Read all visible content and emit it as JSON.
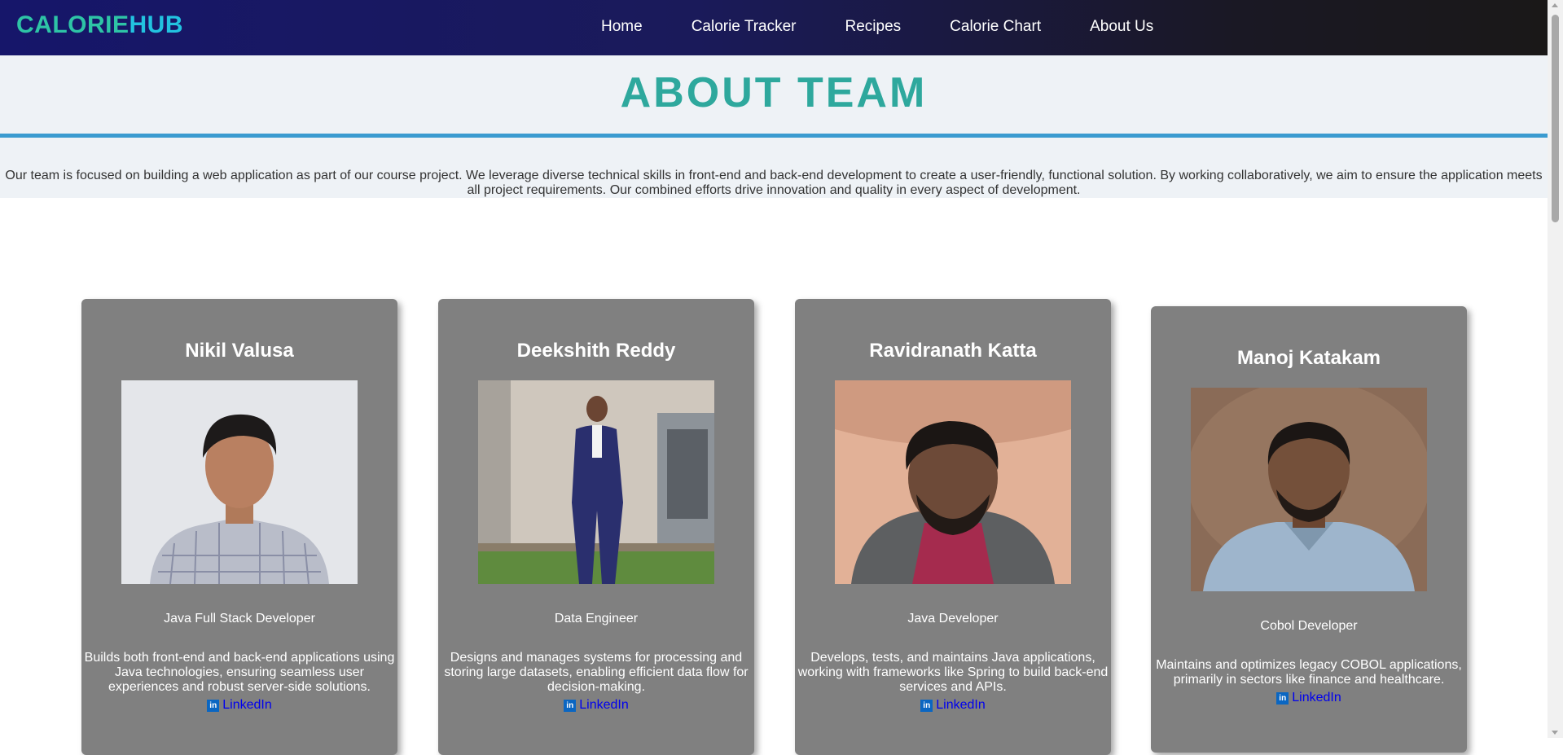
{
  "brand": {
    "part1": "CALORIE",
    "part2": "HUB"
  },
  "nav": [
    "Home",
    "Calorie Tracker",
    "Recipes",
    "Calorie Chart",
    "About Us"
  ],
  "header": {
    "title": "ABOUT TEAM"
  },
  "intro": "Our team is focused on building a web application as part of our course project. We leverage diverse technical skills in front-end and back-end development to create a user-friendly, functional solution. By working collaboratively, we aim to ensure the application meets all project requirements. Our combined efforts drive innovation and quality in every aspect of development.",
  "members": [
    {
      "name": "Nikil Valusa",
      "role": "Java Full Stack Developer",
      "desc": "Builds both front-end and back-end applications using Java technologies, ensuring seamless user experiences and robust server-side solutions.",
      "link": "LinkedIn"
    },
    {
      "name": "Deekshith Reddy",
      "role": "Data Engineer",
      "desc": "Designs and manages systems for processing and storing large datasets, enabling efficient data flow for decision-making.",
      "link": "LinkedIn"
    },
    {
      "name": "Ravidranath Katta",
      "role": "Java Developer",
      "desc": "Develops, tests, and maintains Java applications, working with frameworks like Spring to build back-end services and APIs.",
      "link": "LinkedIn"
    },
    {
      "name": "Manoj Katakam",
      "role": "Cobol Developer",
      "desc": "Maintains and optimizes legacy COBOL applications, primarily in sectors like finance and healthcare.",
      "link": "LinkedIn"
    }
  ],
  "icons": {
    "linkedin": "linkedin-icon"
  },
  "colors": {
    "brand_green": "#2ec4a6",
    "brand_cyan": "#22c3e0",
    "title": "#2ea89d",
    "card_bg": "#808080",
    "link": "#0000ee",
    "header_border": "#3a9bd0"
  }
}
